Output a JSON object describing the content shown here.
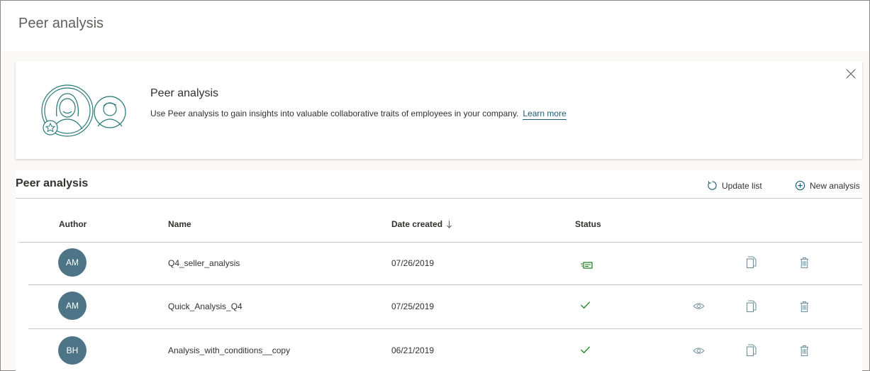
{
  "page": {
    "title": "Peer analysis"
  },
  "banner": {
    "title": "Peer analysis",
    "description": "Use Peer analysis to gain insights into valuable collaborative traits of employees in your company.",
    "learn_more": "Learn more",
    "close_icon": "close-icon",
    "illustration_icon": "peer-people-illustration"
  },
  "section": {
    "title": "Peer analysis",
    "update_list_label": "Update list",
    "new_analysis_label": "New analysis"
  },
  "table": {
    "headers": {
      "author": "Author",
      "name": "Name",
      "date_created": "Date created",
      "status": "Status"
    },
    "sort": {
      "column": "date_created",
      "direction": "descending"
    },
    "rows": [
      {
        "author": "AM",
        "name": "Q4_seller_analysis",
        "date": "07/26/2019",
        "status": "processing",
        "status_icon": "processing-icon",
        "has_view": false
      },
      {
        "author": "AM",
        "name": "Quick_Analysis_Q4",
        "date": "07/25/2019",
        "status": "completed",
        "status_icon": "checkmark-icon",
        "has_view": true
      },
      {
        "author": "BH",
        "name": "Analysis_with_conditions__copy",
        "date": "06/21/2019",
        "status": "completed",
        "status_icon": "checkmark-icon",
        "has_view": true
      }
    ]
  },
  "colors": {
    "avatar": "#4d7587",
    "accent": "#1d5b77",
    "success": "#107c10",
    "icon": "#6f8f9e"
  }
}
